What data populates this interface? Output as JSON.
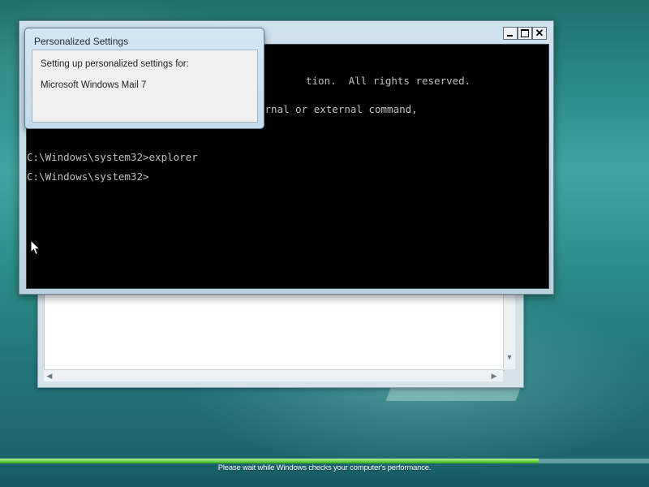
{
  "dialog": {
    "title": "Personalized Settings",
    "line1": "Setting up personalized settings for:",
    "line2": "Microsoft Windows Mail 7"
  },
  "console": {
    "lines": [
      "tion.  All rights reserved.",
      "ernal or external command,",
      "C:\\Windows\\system32>explorer",
      "C:\\Windows\\system32>"
    ],
    "close_glyph": "✕"
  },
  "status": {
    "message": "Please wait while Windows checks your computer's performance.",
    "progress_fraction": 0.83
  },
  "colors": {
    "console_bg": "#000000",
    "console_text": "#c0c0c0",
    "progress": "#5fcf3e"
  },
  "icons": [
    "minimize-icon",
    "maximize-icon",
    "close-icon",
    "scroll-up-icon",
    "scroll-down-icon",
    "scroll-left-icon",
    "scroll-right-icon",
    "mouse-pointer-icon"
  ]
}
